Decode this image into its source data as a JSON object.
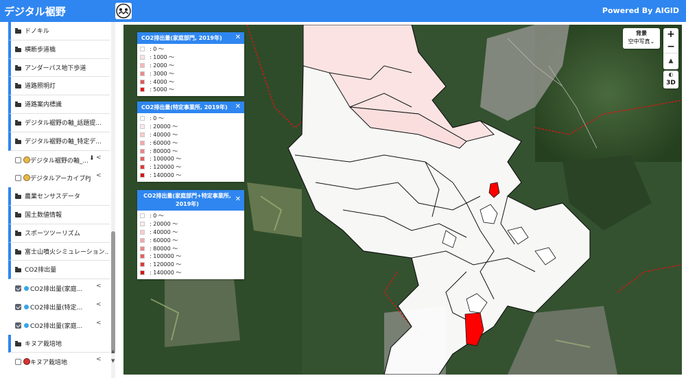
{
  "header": {
    "app_title": "デジタル裾野",
    "powered_by": "Powered By AIGID"
  },
  "sidebar": {
    "items": [
      {
        "type": "folder",
        "label": "ドノキル"
      },
      {
        "type": "folder",
        "label": "横断歩道橋"
      },
      {
        "type": "folder",
        "label": "アンダーパス地下歩道"
      },
      {
        "type": "folder",
        "label": "道路照明灯"
      },
      {
        "type": "folder",
        "label": "道路案内標識"
      },
      {
        "type": "folder",
        "label": "デジタル裾野の軸_話題提..."
      },
      {
        "type": "folder",
        "label": "デジタル裾野の軸_特定デ..."
      },
      {
        "type": "layer",
        "label": "デジタル裾野の軸_...",
        "checked": false,
        "marker": "badge-yellow",
        "download": true,
        "share": true
      },
      {
        "type": "layer",
        "label": "デジタルアーカイブPJ",
        "checked": false,
        "marker": "badge-yellow",
        "download": false,
        "share": true
      },
      {
        "type": "folder",
        "label": "農業センサスデータ"
      },
      {
        "type": "folder",
        "label": "国土数値情報"
      },
      {
        "type": "folder",
        "label": "スポーツツーリズム"
      },
      {
        "type": "folder",
        "label": "富士山噴火シミュレーション..."
      },
      {
        "type": "folder",
        "label": "CO2排出量"
      },
      {
        "type": "layer",
        "label": "CO2排出量(家庭...",
        "checked": true,
        "marker": "dot",
        "download": false,
        "share": true
      },
      {
        "type": "layer",
        "label": "CO2排出量(特定...",
        "checked": true,
        "marker": "dot",
        "download": false,
        "share": true
      },
      {
        "type": "layer",
        "label": "CO2排出量(家庭...",
        "checked": true,
        "marker": "dot",
        "download": false,
        "share": true
      },
      {
        "type": "folder",
        "label": "キヌア栽培地"
      },
      {
        "type": "layer",
        "label": "キヌア栽培地",
        "checked": false,
        "marker": "badge-red",
        "download": false,
        "share": true
      }
    ],
    "scroll_up": "▲",
    "scroll_down": "▼"
  },
  "legends": [
    {
      "title": "CO2排出量(家庭部門, 2019年)",
      "close": "✕",
      "rows": [
        {
          "label": ": 0 ～",
          "color": "#ffffff"
        },
        {
          "label": ": 1000 ～",
          "color": "#fbe3e3"
        },
        {
          "label": ": 2000 ～",
          "color": "#f5b8b8"
        },
        {
          "label": ": 3000 ～",
          "color": "#ee8a8a"
        },
        {
          "label": ": 4000 ～",
          "color": "#e65757"
        },
        {
          "label": ": 5000 ～",
          "color": "#dd1c1c"
        }
      ]
    },
    {
      "title": "CO2排出量(特定事業所, 2019年)",
      "close": "✕",
      "rows": [
        {
          "label": ": 0 ～",
          "color": "#ffffff"
        },
        {
          "label": ": 20000 ～",
          "color": "#fcebeb"
        },
        {
          "label": ": 40000 ～",
          "color": "#f8cccc"
        },
        {
          "label": ": 60000 ～",
          "color": "#f3a9a9"
        },
        {
          "label": ": 80000 ～",
          "color": "#ec8585"
        },
        {
          "label": ": 100000 ～",
          "color": "#e56060"
        },
        {
          "label": ": 120000 ～",
          "color": "#de3a3a"
        },
        {
          "label": ": 140000 ～",
          "color": "#d61616"
        }
      ]
    },
    {
      "title": "CO2排出量(家庭部門+特定事業所, 2019年)",
      "close": "✕",
      "rows": [
        {
          "label": ": 0 ～",
          "color": "#ffffff"
        },
        {
          "label": ": 20000 ～",
          "color": "#fcebeb"
        },
        {
          "label": ": 40000 ～",
          "color": "#f8cccc"
        },
        {
          "label": ": 60000 ～",
          "color": "#f3a9a9"
        },
        {
          "label": ": 80000 ～",
          "color": "#ec8585"
        },
        {
          "label": ": 100000 ～",
          "color": "#e56060"
        },
        {
          "label": ": 120000 ～",
          "color": "#de3a3a"
        },
        {
          "label": ": 140000 ～",
          "color": "#d61616"
        }
      ]
    }
  ],
  "map_controls": {
    "basemap_title": "背景",
    "basemap_value": "空中写真",
    "zoom_in": "+",
    "zoom_out": "−",
    "compass": "▲",
    "theme_toggle": "◐",
    "three_d": "3D"
  },
  "colors": {
    "accent": "#2f86f0",
    "boundary": "#d01818",
    "highlight": "#ff0000"
  }
}
